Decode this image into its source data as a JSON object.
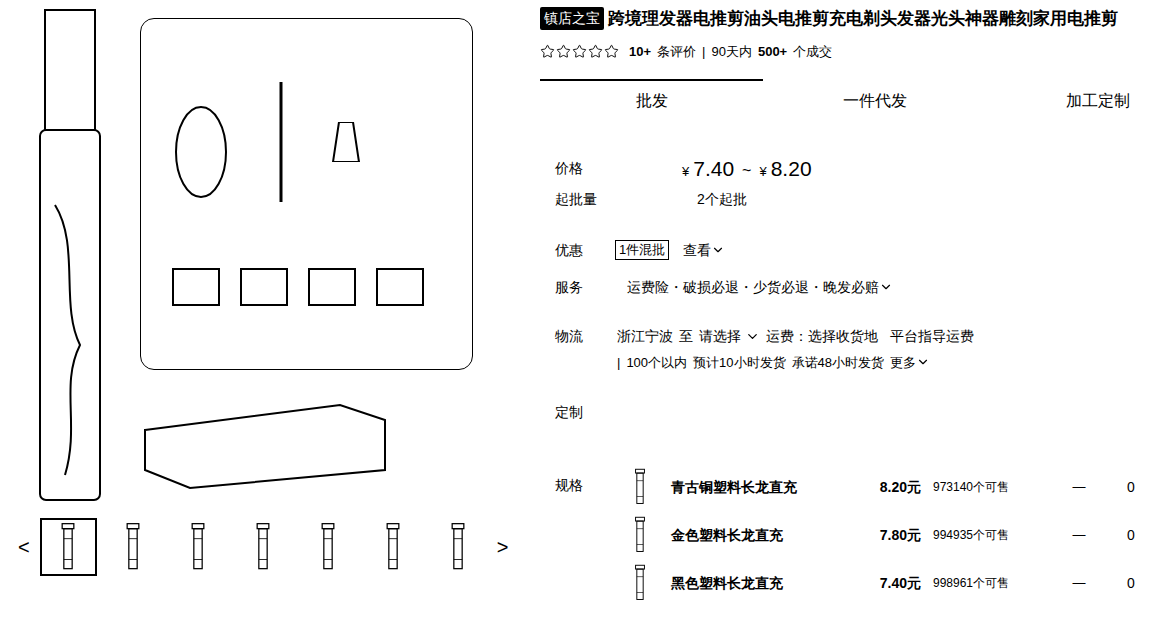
{
  "badge": "镇店之宝",
  "title": "跨境理发器电推剪油头电推剪充电剃头发器光头神器雕刻家用电推剪",
  "rating": {
    "stars": 0,
    "max": 5,
    "review_count": "10+",
    "review_label": "条评价",
    "separator": "|",
    "period": "90天内",
    "deals": "500+",
    "deals_label": "个成交"
  },
  "tabs": [
    {
      "label": "批发",
      "selected": true
    },
    {
      "label": "一件代发",
      "selected": false
    },
    {
      "label": "加工定制",
      "selected": false
    }
  ],
  "price": {
    "label": "价格",
    "currency": "¥",
    "low": "7.40",
    "tilde": "~",
    "high": "8.20"
  },
  "moq": {
    "label": "起批量",
    "value": "2个起批"
  },
  "promo": {
    "label": "优惠",
    "tag": "1件混批",
    "link": "查看"
  },
  "service": {
    "label": "服务",
    "items": "运费险・破损必退・少货必退・晚发必赔"
  },
  "logistics": {
    "label": "物流",
    "origin": "浙江宁波",
    "to": "至",
    "dest": "请选择",
    "fee": "运费：选择收货地",
    "guide": "平台指导运费",
    "separator": "|",
    "notes": [
      "100个以内",
      "预计10小时发货",
      "承诺48小时发货"
    ],
    "more": "更多"
  },
  "custom": {
    "label": "定制"
  },
  "specs": {
    "label": "规格",
    "rows": [
      {
        "name": "青古铜塑料长龙直充",
        "price": "8.20元",
        "stock": "973140个可售",
        "dash": "—",
        "qty": "0"
      },
      {
        "name": "金色塑料长龙直充",
        "price": "7.80元",
        "stock": "994935个可售",
        "dash": "—",
        "qty": "0"
      },
      {
        "name": "黑色塑料长龙直充",
        "price": "7.40元",
        "stock": "998961个可售",
        "dash": "—",
        "qty": "0"
      }
    ]
  },
  "gallery": {
    "prev": "<",
    "next": ">",
    "thumbnails": [
      {
        "selected": true
      },
      {
        "selected": false
      },
      {
        "selected": false
      },
      {
        "selected": false
      },
      {
        "selected": false
      },
      {
        "selected": false
      },
      {
        "selected": false
      }
    ]
  }
}
